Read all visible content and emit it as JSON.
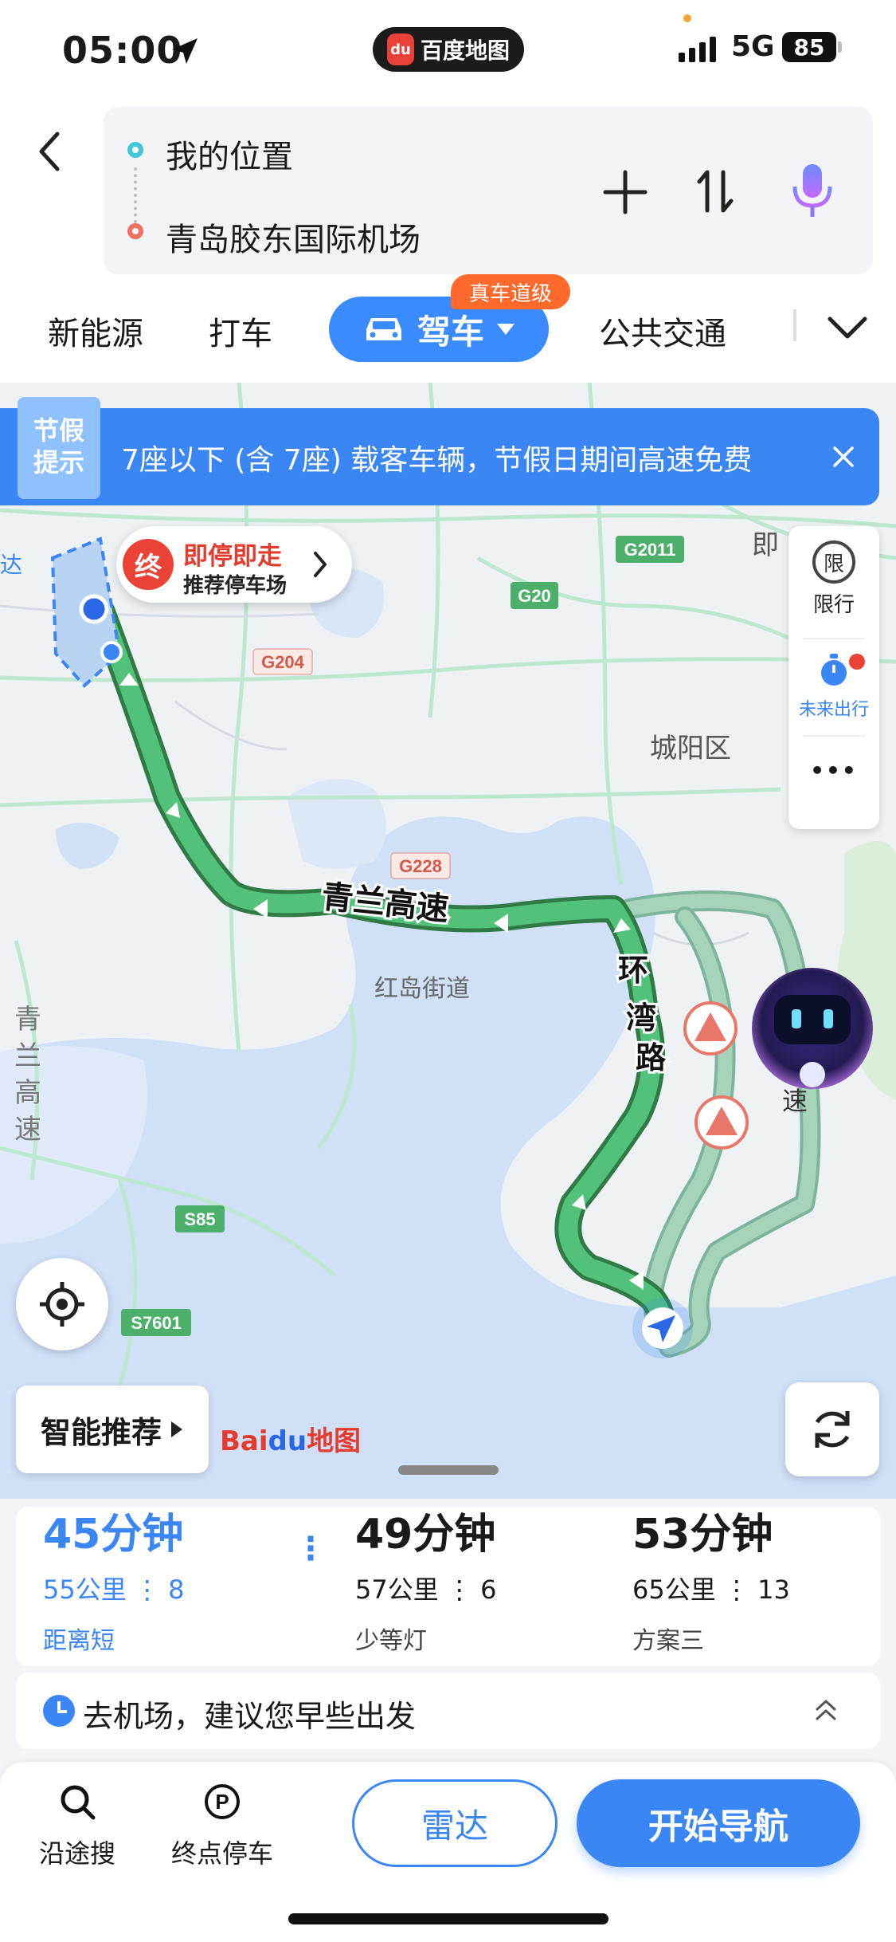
{
  "status_bar": {
    "time": "05:00",
    "app_name": "百度地图",
    "network": "5G",
    "battery": "85"
  },
  "route_input": {
    "origin": "我的位置",
    "destination": "青岛胶东国际机场"
  },
  "modes": {
    "new_energy": "新能源",
    "taxi": "打车",
    "drive": "驾车",
    "drive_badge": "真车道级",
    "transit": "公共交通"
  },
  "notice": {
    "tag_line1": "节假",
    "tag_line2": "提示",
    "text": "7座以下 (含 7座) 载客车辆，节假日期间高速免费"
  },
  "destination_popup": {
    "badge": "终",
    "title": "即停即走",
    "subtitle": "推荐停车场"
  },
  "side_tools": {
    "restriction_icon_text": "限",
    "restriction_label": "限行",
    "future_label": "未来出行",
    "more": "•••"
  },
  "map_labels": {
    "g2011": "G2011",
    "g20": "G20",
    "g204": "G204",
    "g228": "G228",
    "s85": "S85",
    "s7601": "S7601",
    "chengyang": "城阳区",
    "hongdao": "红岛街道",
    "ji": "即",
    "da": "达",
    "qinglan_h": "青兰高速",
    "qinglan_v": [
      "青",
      "兰",
      "高",
      "速"
    ],
    "huanwan": [
      "环",
      "湾",
      "路"
    ],
    "su": "速"
  },
  "smart_recommend": "智能推荐",
  "logo": {
    "bai": "Bai",
    "du": "du",
    "ditu": "地图"
  },
  "routes": [
    {
      "time": "45分钟",
      "distance": "55公里",
      "lights": "8",
      "tag": "距离短",
      "selected": true
    },
    {
      "time": "49分钟",
      "distance": "57公里",
      "lights": "6",
      "tag": "少等灯",
      "selected": false
    },
    {
      "time": "53分钟",
      "distance": "65公里",
      "lights": "13",
      "tag": "方案三",
      "selected": false
    }
  ],
  "advice": "去机场，建议您早些出发",
  "bottom": {
    "search_along": "沿途搜",
    "dest_parking": "终点停车",
    "radar": "雷达",
    "start_nav": "开始导航"
  },
  "colors": {
    "accent": "#3a86f5",
    "route": "#4cb86e",
    "alt_route": "#9ccfb3",
    "map_bg": "#eef2f5",
    "water": "#cfe0f7"
  }
}
